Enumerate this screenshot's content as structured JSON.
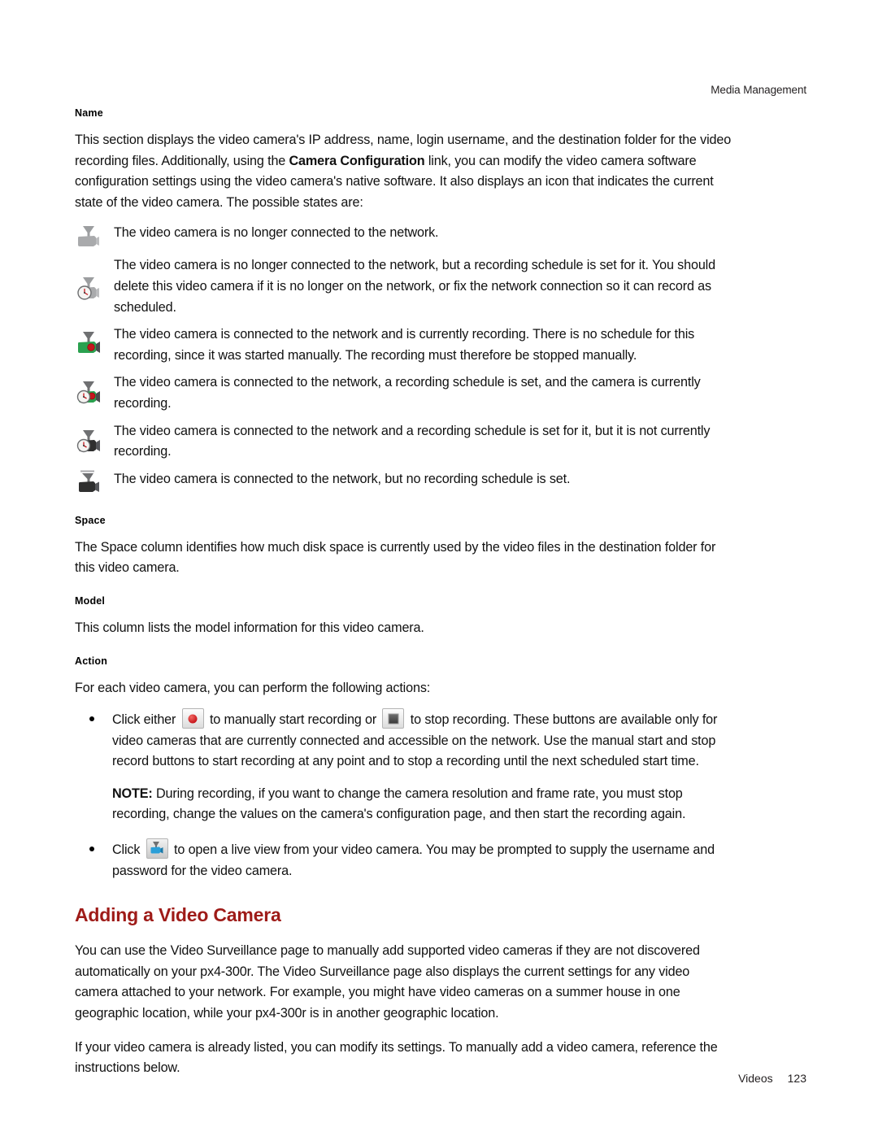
{
  "header": {
    "running_head": "Media Management"
  },
  "sections": {
    "name": {
      "heading": "Name",
      "paragraph_part1": "This section displays the video camera's IP address, name, login username, and the destination folder for the video recording files. Additionally, using the ",
      "paragraph_bold": "Camera Configuration",
      "paragraph_part2": " link, you can modify the video camera software configuration settings using the video camera's native software. It also displays an icon that indicates the current state of the video camera. The possible states are:",
      "states": [
        {
          "icon": "camera-gray-disconnected-icon",
          "text": "The video camera is no longer connected to the network."
        },
        {
          "icon": "camera-gray-clock-disconnected-scheduled-icon",
          "text": "The video camera is no longer connected to the network, but a recording schedule is set for it. You should delete this video camera if it is no longer on the network, or fix the network connection so it can record as scheduled."
        },
        {
          "icon": "camera-green-recording-icon",
          "text": "The video camera is connected to the network and is currently recording. There is no schedule for this recording, since it was started manually. The recording must therefore be stopped manually."
        },
        {
          "icon": "camera-green-clock-recording-scheduled-icon",
          "text": "The video camera is connected to the network, a recording schedule is set, and the camera is currently recording."
        },
        {
          "icon": "camera-dark-clock-scheduled-icon",
          "text": "The video camera is connected to the network and a recording schedule is set for it, but it is not currently recording."
        },
        {
          "icon": "camera-dark-connected-icon",
          "text": "The video camera is connected to the network, but no recording schedule is set."
        }
      ]
    },
    "space": {
      "heading": "Space",
      "paragraph": "The Space column identifies how much disk space is currently used by the video files in the destination folder for this video camera."
    },
    "model": {
      "heading": "Model",
      "paragraph": "This column lists the model information for this video camera."
    },
    "action": {
      "heading": "Action",
      "paragraph": "For each video camera, you can perform the following actions:",
      "bullet1_part1": "Click either ",
      "bullet1_part2": " to manually start recording or ",
      "bullet1_part3": " to stop recording. These buttons are available only for video cameras that are currently connected and accessible on the network. Use the manual start and stop record buttons to start recording at any point and to stop a recording until the next scheduled start time.",
      "note_label": "NOTE:",
      "note_text": " During recording, if you want to change the camera resolution and frame rate, you must stop recording, change the values on the camera's configuration page, and then start the recording again.",
      "bullet2_part1": "Click ",
      "bullet2_part2": " to open a live view from your video camera. You may be prompted to supply the username and password for the video camera."
    },
    "adding": {
      "heading": "Adding a Video Camera",
      "paragraph1": "You can use the Video Surveillance page to manually add supported video cameras if they are not discovered automatically on your px4-300r. The Video Surveillance page also displays the current settings for any video camera attached to your network. For example, you might have video cameras on a summer house in one geographic location, while your px4-300r is in another geographic location.",
      "paragraph2": "If your video camera is already listed, you can modify its settings. To manually add a video camera, reference the instructions below."
    }
  },
  "footer": {
    "label": "Videos",
    "page_number": "123"
  },
  "colors": {
    "heading_red": "#9e1b18",
    "record_red": "#c8161d",
    "camera_green": "#2aa14f",
    "camera_gray": "#a9aaac",
    "camera_dark": "#2f2f2f",
    "live_blue": "#2b9fd8"
  }
}
